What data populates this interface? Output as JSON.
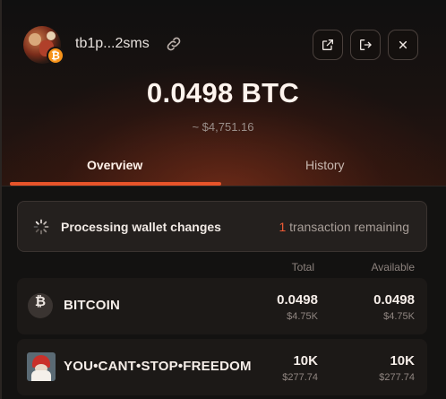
{
  "header": {
    "address": "tb1p...2sms",
    "avatar_badge": "₿",
    "icons": [
      "copy-link-icon",
      "open-external-icon",
      "logout-icon",
      "close-icon"
    ]
  },
  "balance": {
    "amount": "0.0498 BTC",
    "fiat": "~ $4,751.16"
  },
  "tabs": [
    {
      "label": "Overview",
      "active": true
    },
    {
      "label": "History",
      "active": false
    }
  ],
  "processing": {
    "label": "Processing wallet changes",
    "count": "1",
    "suffix": " transaction remaining"
  },
  "table": {
    "columns": [
      "Total",
      "Available"
    ],
    "rows": [
      {
        "name": "BITCOIN",
        "icon": "₿",
        "total": "0.0498",
        "total_fiat": "$4.75K",
        "available": "0.0498",
        "available_fiat": "$4.75K"
      },
      {
        "name": "YOU•CANT•STOP•FREEDOM",
        "total": "10K",
        "total_fiat": "$277.74",
        "available": "10K",
        "available_fiat": "$277.74"
      }
    ]
  },
  "colors": {
    "accent": "#e8542a",
    "background": "#131211",
    "row_background": "#1c1917",
    "bitcoin_orange": "#f7931a"
  }
}
